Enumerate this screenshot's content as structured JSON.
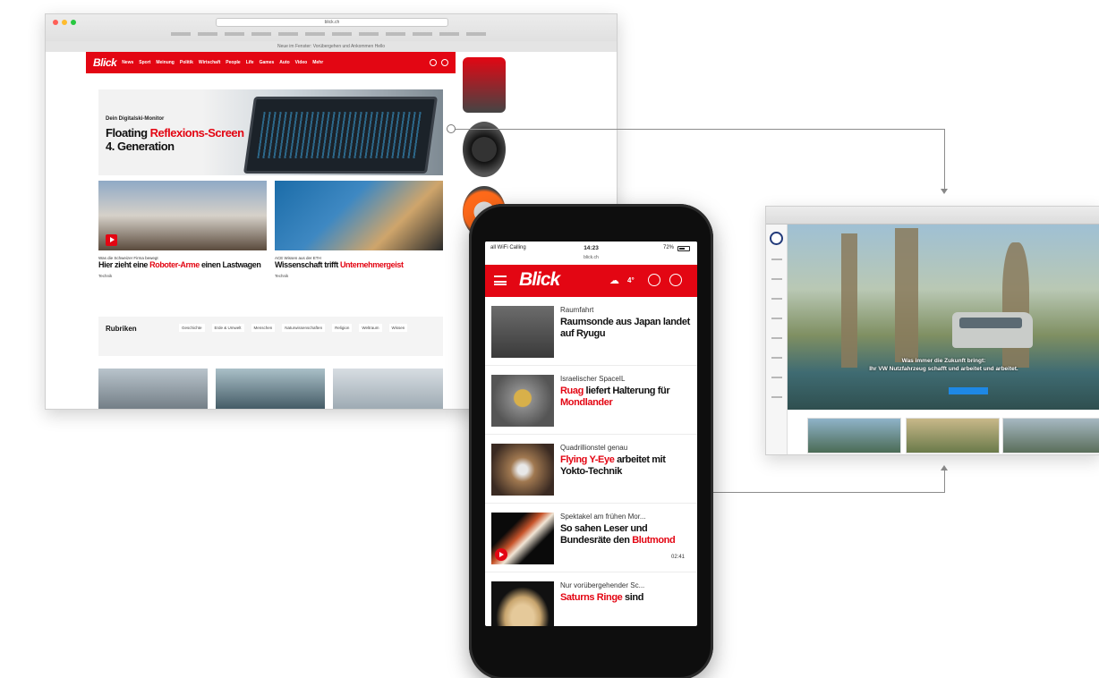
{
  "desktop": {
    "url": "blick.ch",
    "infobar": "Neue im Fenster: Vorübergehen und Ankommen Hello",
    "logo": "Blick",
    "nav": [
      "News",
      "Sport",
      "Meinung",
      "Politik",
      "Wirtschaft",
      "People",
      "Life",
      "Games",
      "Auto",
      "Video",
      "Mehr"
    ],
    "hero": {
      "kicker": "Dein Digitalski-Monitor",
      "title_a": "Floating ",
      "title_red": "Reflexions-Screen",
      "title_b": "4. Generation"
    },
    "cards": [
      {
        "kicker": "Was die Schweizer Firma bewegt",
        "title_a": "Hier zieht eine ",
        "title_red": "Roboter-Arme",
        "title_b": " einen Lastwagen",
        "meta": "Technik"
      },
      {
        "kicker": "ACE Wissen aus der ETH",
        "title_a": "Wissenschaft trifft ",
        "title_red": "Unternehmergeist",
        "title_b": "",
        "meta": "Technik"
      }
    ],
    "rubriken": {
      "title": "Rubriken",
      "links": [
        "Geschichte",
        "Erde & Umwelt",
        "Menschen",
        "Naturwissenschaften",
        "Religion",
        "Weltraum",
        "Wissen"
      ]
    }
  },
  "phone": {
    "status": {
      "carrier": "all WiFi Calling",
      "time": "14:23",
      "url": "blick.ch",
      "battery": "72%"
    },
    "logo": "Blick",
    "weather": "4°",
    "articles": [
      {
        "kicker": "Raumfahrt",
        "title_a": "Raumsonde aus Japan landet auf Ryugu",
        "title_red": "",
        "title_b": "",
        "duration": ""
      },
      {
        "kicker": "Israelischer SpaceIL",
        "title_a": "",
        "title_red": "Ruag",
        "title_b": " liefert Halterung für ",
        "title_red2": "Mondlander",
        "duration": ""
      },
      {
        "kicker": "Quadrillionstel genau",
        "title_a": "",
        "title_red": "Flying Y-Eye",
        "title_b": " arbeitet mit Yokto-Technik",
        "duration": ""
      },
      {
        "kicker": "Spektakel am frühen Mor...",
        "title_a": "So sahen Leser und Bundesräte den ",
        "title_red": "Blutmond",
        "title_b": "",
        "duration": "02:41"
      },
      {
        "kicker": "Nur vorübergehender Sc...",
        "title_a": "",
        "title_red": "Saturns Ringe",
        "title_b": " sind",
        "duration": ""
      }
    ]
  },
  "right_window": {
    "banner_text_1": "Was immer die Zukunft bringt:",
    "banner_text_2": "Ihr VW Nutzfahrzeug schafft und arbeitet und arbeitet.",
    "cta_label": ""
  },
  "colors": {
    "brand_red": "#e30613",
    "text": "#111111"
  }
}
